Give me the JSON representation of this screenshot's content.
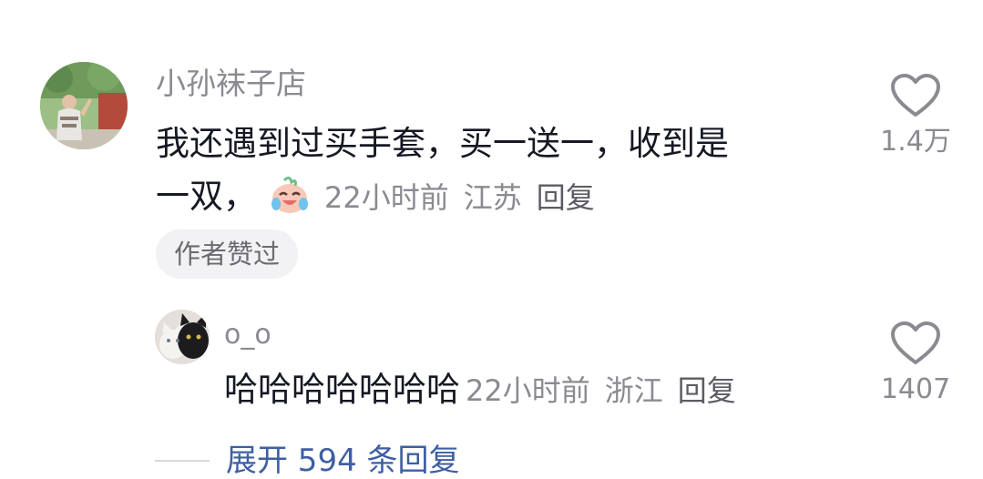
{
  "comment": {
    "username": "小孙袜子店",
    "text_line1": "我还遇到过买手套，买一送一，收到是",
    "text_line2": "一双，",
    "emoji": "crying-laughing-emoji",
    "time": "22小时前",
    "location": "江苏",
    "reply_label": "回复",
    "author_liked_tag": "作者赞过",
    "like_count": "1.4万"
  },
  "reply": {
    "username": "o_o",
    "text": "哈哈哈哈哈哈哈",
    "time": "22小时前",
    "location": "浙江",
    "reply_label": "回复",
    "like_count": "1407"
  },
  "expand": {
    "label": "展开 594 条回复"
  },
  "colors": {
    "text": "#161823",
    "meta": "#8a8b91",
    "link": "#3e5fa3",
    "tag_bg": "#f2f2f4"
  }
}
